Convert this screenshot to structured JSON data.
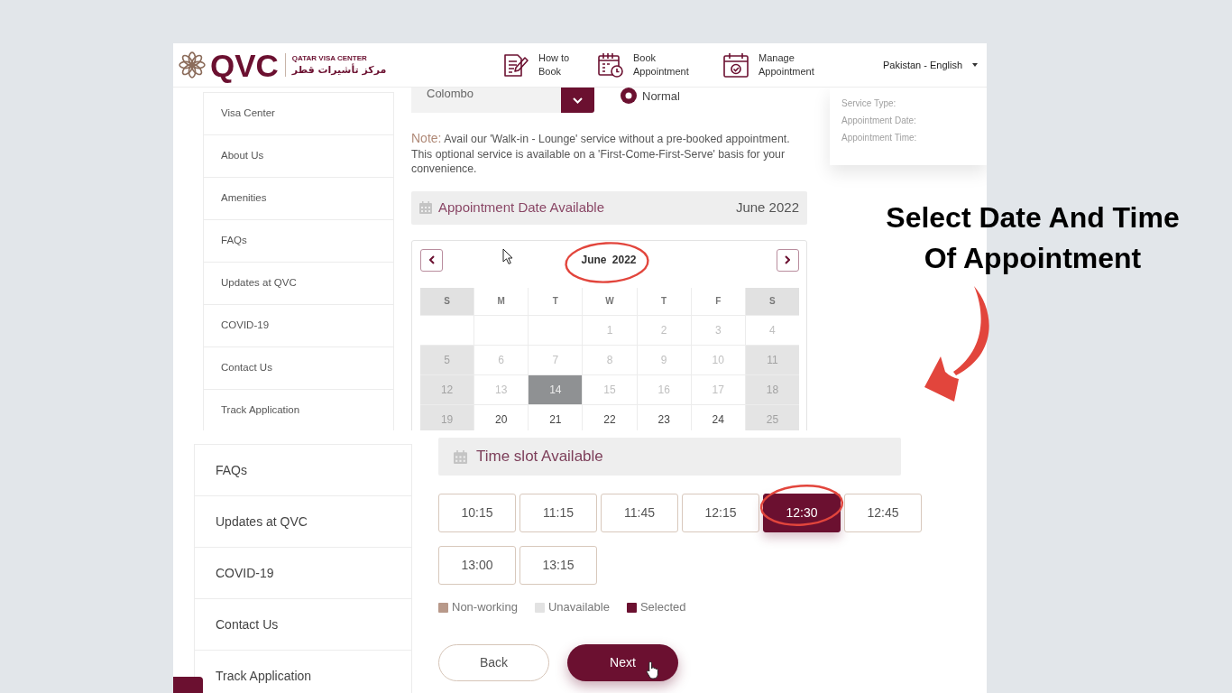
{
  "top_screenshot": {
    "header": {
      "logo": {
        "wordmark": "QVC",
        "name": "QATAR VISA CENTER",
        "name_arabic": "مركز تأشيرات قطر"
      },
      "nav": [
        {
          "kind": "how_to",
          "label": "How to\nBook"
        },
        {
          "kind": "book",
          "label": "Book\nAppointment"
        },
        {
          "kind": "manage",
          "label": "Manage\nAppointment"
        }
      ],
      "language": "Pakistan - English"
    },
    "sidebar": {
      "items": [
        "Visa Center",
        "About Us",
        "Amenities",
        "FAQs",
        "Updates at QVC",
        "COVID-19",
        "Contact Us",
        "Track Application"
      ]
    },
    "location_select": {
      "value": "Colombo"
    },
    "service_type": [
      {
        "label": "Normal",
        "selected": true
      }
    ],
    "note": {
      "label": "Note:",
      "text": "Avail our 'Walk-in - Lounge' service without a pre-booked appointment. This optional service is available on a 'First-Come-First-Serve' basis for your convenience."
    },
    "date_bar": {
      "title": "Appointment Date Available",
      "month": "June 2022"
    },
    "calendar": {
      "title": "June 2022",
      "title_circled": true,
      "weekdays": [
        {
          "label": "S",
          "weekend": true
        },
        {
          "label": "M",
          "weekend": false
        },
        {
          "label": "T",
          "weekend": false
        },
        {
          "label": "W",
          "weekend": false
        },
        {
          "label": "T",
          "weekend": false
        },
        {
          "label": "F",
          "weekend": false
        },
        {
          "label": "S",
          "weekend": true
        }
      ],
      "weeks": [
        [
          {
            "kind": "empty"
          },
          {
            "kind": "empty"
          },
          {
            "kind": "empty"
          },
          {
            "day": "1",
            "kind": "unavailable"
          },
          {
            "day": "2",
            "kind": "unavailable"
          },
          {
            "day": "3",
            "kind": "unavailable"
          },
          {
            "day": "4",
            "kind": "unavailable"
          }
        ],
        [
          {
            "day": "5",
            "kind": "non_working"
          },
          {
            "day": "6",
            "kind": "unavailable"
          },
          {
            "day": "7",
            "kind": "unavailable"
          },
          {
            "day": "8",
            "kind": "unavailable"
          },
          {
            "day": "9",
            "kind": "unavailable"
          },
          {
            "day": "10",
            "kind": "unavailable"
          },
          {
            "day": "11",
            "kind": "non_working"
          }
        ],
        [
          {
            "day": "12",
            "kind": "non_working"
          },
          {
            "day": "13",
            "kind": "unavailable"
          },
          {
            "day": "14",
            "kind": "marked"
          },
          {
            "day": "15",
            "kind": "unavailable"
          },
          {
            "day": "16",
            "kind": "unavailable"
          },
          {
            "day": "17",
            "kind": "unavailable"
          },
          {
            "day": "18",
            "kind": "non_working"
          }
        ],
        [
          {
            "day": "19",
            "kind": "non_working"
          },
          {
            "day": "20",
            "kind": "available"
          },
          {
            "day": "21",
            "kind": "available"
          },
          {
            "day": "22",
            "kind": "available"
          },
          {
            "day": "23",
            "kind": "available"
          },
          {
            "day": "24",
            "kind": "available"
          },
          {
            "day": "25",
            "kind": "non_working"
          }
        ]
      ]
    },
    "summary": {
      "fields": [
        "Service Type:",
        "Appointment Date:",
        "Appointment Time:"
      ]
    }
  },
  "bottom_screenshot": {
    "sidebar": {
      "items": [
        "FAQs",
        "Updates at QVC",
        "COVID-19",
        "Contact Us",
        "Track Application"
      ]
    },
    "time_bar": {
      "title": "Time slot Available"
    },
    "slots": [
      {
        "label": "10:15",
        "selected": false,
        "circled": false
      },
      {
        "label": "11:15",
        "selected": false,
        "circled": false
      },
      {
        "label": "11:45",
        "selected": false,
        "circled": false
      },
      {
        "label": "12:15",
        "selected": false,
        "circled": false
      },
      {
        "label": "12:30",
        "selected": true,
        "circled": true
      },
      {
        "label": "12:45",
        "selected": false,
        "circled": false
      },
      {
        "label": "13:00",
        "selected": false,
        "circled": false
      },
      {
        "label": "13:15",
        "selected": false,
        "circled": false
      }
    ],
    "legend": [
      {
        "label": "Non-working",
        "color": "#b8998a"
      },
      {
        "label": "Unavailable",
        "color": "#e2e2e2"
      },
      {
        "label": "Selected",
        "color": "#6b1030"
      }
    ],
    "buttons": [
      {
        "kind": "secondary",
        "label": "Back"
      },
      {
        "kind": "primary",
        "label": "Next"
      }
    ]
  },
  "annotation": {
    "caption": "Select Date And Time Of Appointment"
  }
}
